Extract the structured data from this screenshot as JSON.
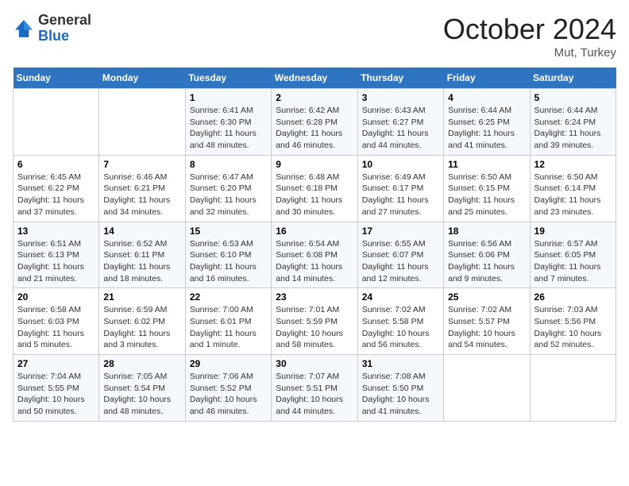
{
  "header": {
    "logo_line1": "General",
    "logo_line2": "Blue",
    "month": "October 2024",
    "location": "Mut, Turkey"
  },
  "days_of_week": [
    "Sunday",
    "Monday",
    "Tuesday",
    "Wednesday",
    "Thursday",
    "Friday",
    "Saturday"
  ],
  "weeks": [
    [
      {
        "num": "",
        "info": ""
      },
      {
        "num": "",
        "info": ""
      },
      {
        "num": "1",
        "info": "Sunrise: 6:41 AM\nSunset: 6:30 PM\nDaylight: 11 hours and 48 minutes."
      },
      {
        "num": "2",
        "info": "Sunrise: 6:42 AM\nSunset: 6:28 PM\nDaylight: 11 hours and 46 minutes."
      },
      {
        "num": "3",
        "info": "Sunrise: 6:43 AM\nSunset: 6:27 PM\nDaylight: 11 hours and 44 minutes."
      },
      {
        "num": "4",
        "info": "Sunrise: 6:44 AM\nSunset: 6:25 PM\nDaylight: 11 hours and 41 minutes."
      },
      {
        "num": "5",
        "info": "Sunrise: 6:44 AM\nSunset: 6:24 PM\nDaylight: 11 hours and 39 minutes."
      }
    ],
    [
      {
        "num": "6",
        "info": "Sunrise: 6:45 AM\nSunset: 6:22 PM\nDaylight: 11 hours and 37 minutes."
      },
      {
        "num": "7",
        "info": "Sunrise: 6:46 AM\nSunset: 6:21 PM\nDaylight: 11 hours and 34 minutes."
      },
      {
        "num": "8",
        "info": "Sunrise: 6:47 AM\nSunset: 6:20 PM\nDaylight: 11 hours and 32 minutes."
      },
      {
        "num": "9",
        "info": "Sunrise: 6:48 AM\nSunset: 6:18 PM\nDaylight: 11 hours and 30 minutes."
      },
      {
        "num": "10",
        "info": "Sunrise: 6:49 AM\nSunset: 6:17 PM\nDaylight: 11 hours and 27 minutes."
      },
      {
        "num": "11",
        "info": "Sunrise: 6:50 AM\nSunset: 6:15 PM\nDaylight: 11 hours and 25 minutes."
      },
      {
        "num": "12",
        "info": "Sunrise: 6:50 AM\nSunset: 6:14 PM\nDaylight: 11 hours and 23 minutes."
      }
    ],
    [
      {
        "num": "13",
        "info": "Sunrise: 6:51 AM\nSunset: 6:13 PM\nDaylight: 11 hours and 21 minutes."
      },
      {
        "num": "14",
        "info": "Sunrise: 6:52 AM\nSunset: 6:11 PM\nDaylight: 11 hours and 18 minutes."
      },
      {
        "num": "15",
        "info": "Sunrise: 6:53 AM\nSunset: 6:10 PM\nDaylight: 11 hours and 16 minutes."
      },
      {
        "num": "16",
        "info": "Sunrise: 6:54 AM\nSunset: 6:08 PM\nDaylight: 11 hours and 14 minutes."
      },
      {
        "num": "17",
        "info": "Sunrise: 6:55 AM\nSunset: 6:07 PM\nDaylight: 11 hours and 12 minutes."
      },
      {
        "num": "18",
        "info": "Sunrise: 6:56 AM\nSunset: 6:06 PM\nDaylight: 11 hours and 9 minutes."
      },
      {
        "num": "19",
        "info": "Sunrise: 6:57 AM\nSunset: 6:05 PM\nDaylight: 11 hours and 7 minutes."
      }
    ],
    [
      {
        "num": "20",
        "info": "Sunrise: 6:58 AM\nSunset: 6:03 PM\nDaylight: 11 hours and 5 minutes."
      },
      {
        "num": "21",
        "info": "Sunrise: 6:59 AM\nSunset: 6:02 PM\nDaylight: 11 hours and 3 minutes."
      },
      {
        "num": "22",
        "info": "Sunrise: 7:00 AM\nSunset: 6:01 PM\nDaylight: 11 hours and 1 minute."
      },
      {
        "num": "23",
        "info": "Sunrise: 7:01 AM\nSunset: 5:59 PM\nDaylight: 10 hours and 58 minutes."
      },
      {
        "num": "24",
        "info": "Sunrise: 7:02 AM\nSunset: 5:58 PM\nDaylight: 10 hours and 56 minutes."
      },
      {
        "num": "25",
        "info": "Sunrise: 7:02 AM\nSunset: 5:57 PM\nDaylight: 10 hours and 54 minutes."
      },
      {
        "num": "26",
        "info": "Sunrise: 7:03 AM\nSunset: 5:56 PM\nDaylight: 10 hours and 52 minutes."
      }
    ],
    [
      {
        "num": "27",
        "info": "Sunrise: 7:04 AM\nSunset: 5:55 PM\nDaylight: 10 hours and 50 minutes."
      },
      {
        "num": "28",
        "info": "Sunrise: 7:05 AM\nSunset: 5:54 PM\nDaylight: 10 hours and 48 minutes."
      },
      {
        "num": "29",
        "info": "Sunrise: 7:06 AM\nSunset: 5:52 PM\nDaylight: 10 hours and 46 minutes."
      },
      {
        "num": "30",
        "info": "Sunrise: 7:07 AM\nSunset: 5:51 PM\nDaylight: 10 hours and 44 minutes."
      },
      {
        "num": "31",
        "info": "Sunrise: 7:08 AM\nSunset: 5:50 PM\nDaylight: 10 hours and 41 minutes."
      },
      {
        "num": "",
        "info": ""
      },
      {
        "num": "",
        "info": ""
      }
    ]
  ]
}
